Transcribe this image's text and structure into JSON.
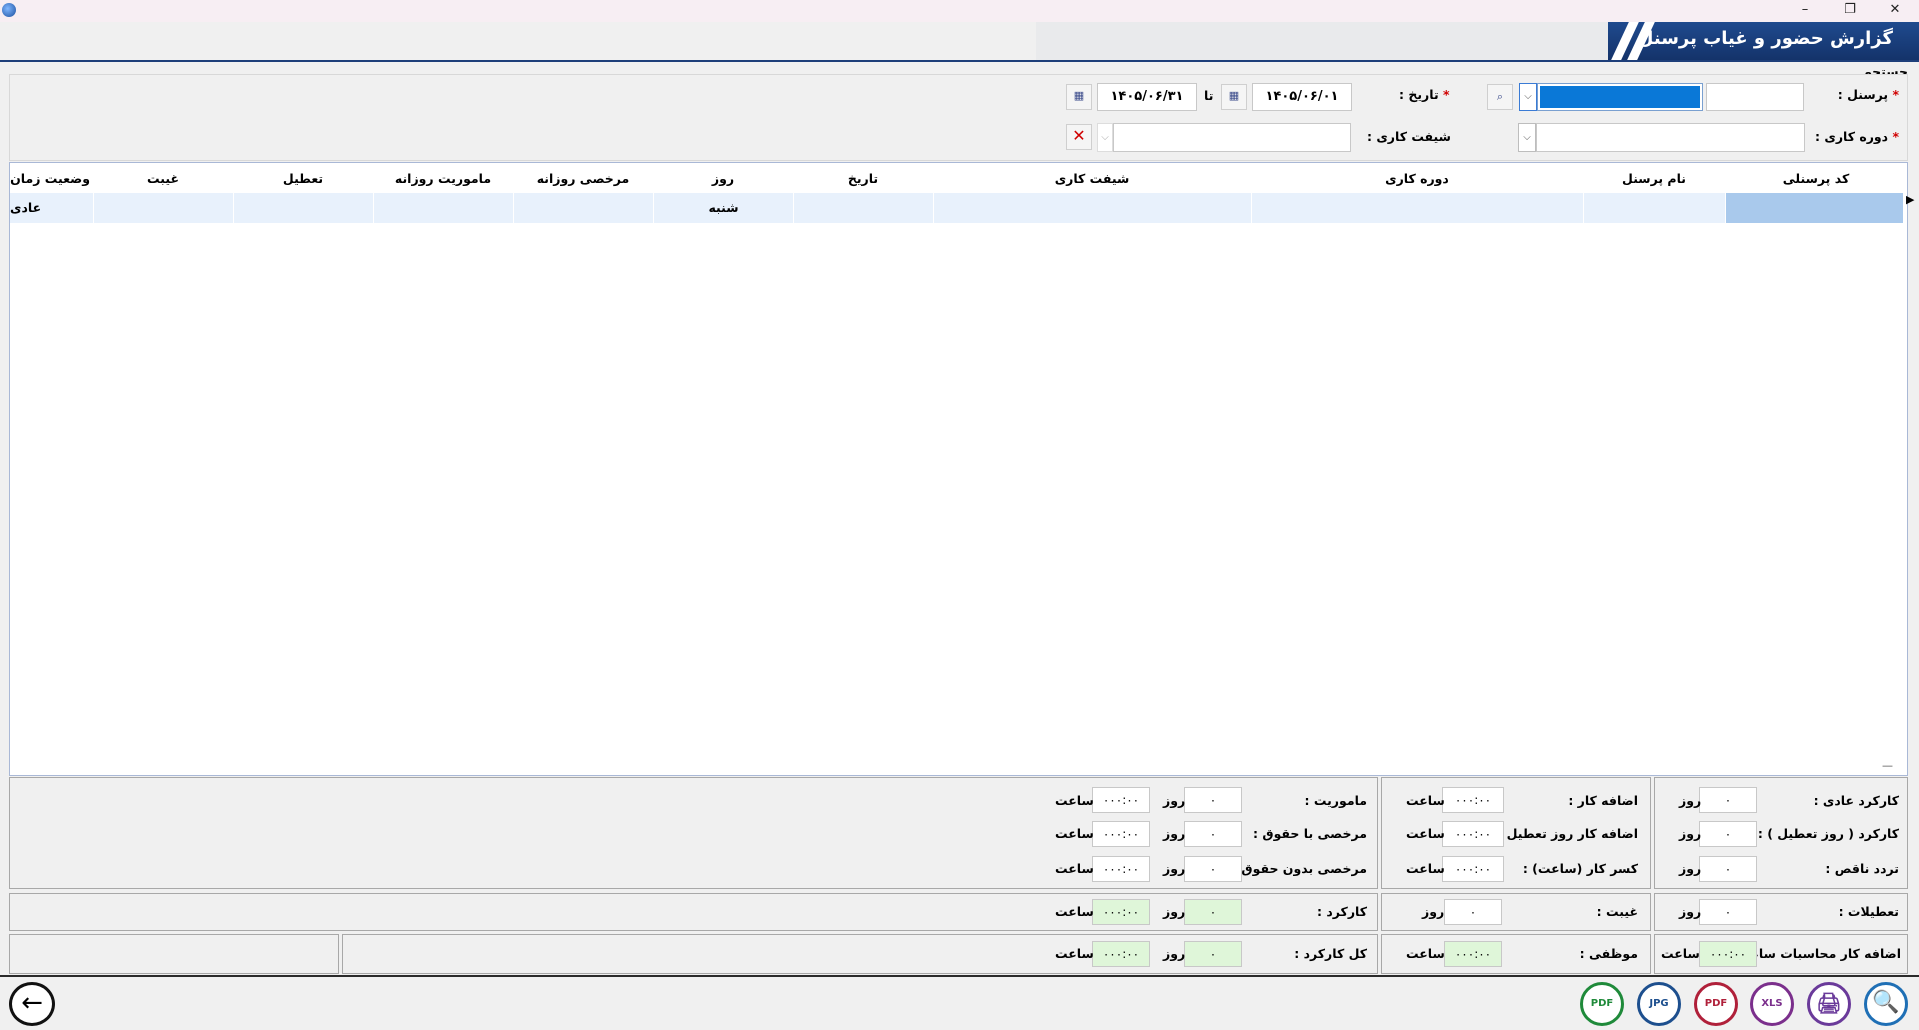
{
  "window": {
    "title": "گزارش حضور و غیاب پرسنل",
    "minimize": "–",
    "restore": "❐",
    "close": "✕"
  },
  "search": {
    "section_label": "جستجو",
    "personnel_label": "پرسنل :",
    "date_label": "تاریخ :",
    "date_from": "۱۴۰۵/۰۶/۰۱",
    "date_to_label": "تا",
    "date_to": "۱۴۰۵/۰۶/۳۱",
    "work_period_label": "دوره کاری :",
    "work_shift_label": "شیفت کاری :",
    "required_mark": "*"
  },
  "grid": {
    "columns": [
      "کد پرسنلی",
      "نام پرسنل",
      "دوره کاری",
      "شیفت کاری",
      "تاریخ",
      "روز",
      "مرخصی روزانه",
      "ماموریت روزانه",
      "تعطیل",
      "غیبت",
      "وضعیت زمان و"
    ],
    "rows": [
      {
        "code": "",
        "name": "",
        "period": "",
        "shift": "",
        "date": "",
        "day": "شنبه",
        "daily_leave": "",
        "daily_mission": "",
        "holiday": "",
        "absence": "",
        "status": "عادی"
      }
    ]
  },
  "summary": {
    "normal_work_label": "کارکرد عادی :",
    "holiday_work_label": "کارکرد ( روز تعطیل ) :",
    "incomplete_label": "تردد ناقص :",
    "overtime_label": "اضافه کار :",
    "overtime_holiday_label": "اضافه کار   روز تعطیل :",
    "deficit_label": "کسر کار (ساعت) :",
    "mission_label": "ماموریت :",
    "paid_leave_label": "مرخصی با حقوق :",
    "unpaid_leave_label": "مرخصی بدون حقوق :",
    "holidays_label": "تعطیلات :",
    "absence_label": "غیبت :",
    "work_label": "کارکرد :",
    "hourly_overtime_label": "اضافه کار محاسبات ساعتی:",
    "mandatory_label": "موظفی :",
    "total_work_label": "کل کارکرد :",
    "day_unit": "روز",
    "hour_unit": "ساعت",
    "zero": "۰",
    "zero_time": "۰۰۰:۰۰"
  },
  "toolbar": {
    "back": "←",
    "search_icon": "🔍",
    "print_icon": "🖨",
    "xls": "XLS",
    "pdf": "PDF",
    "jpg": "JPG",
    "pdf2": "PDF"
  }
}
